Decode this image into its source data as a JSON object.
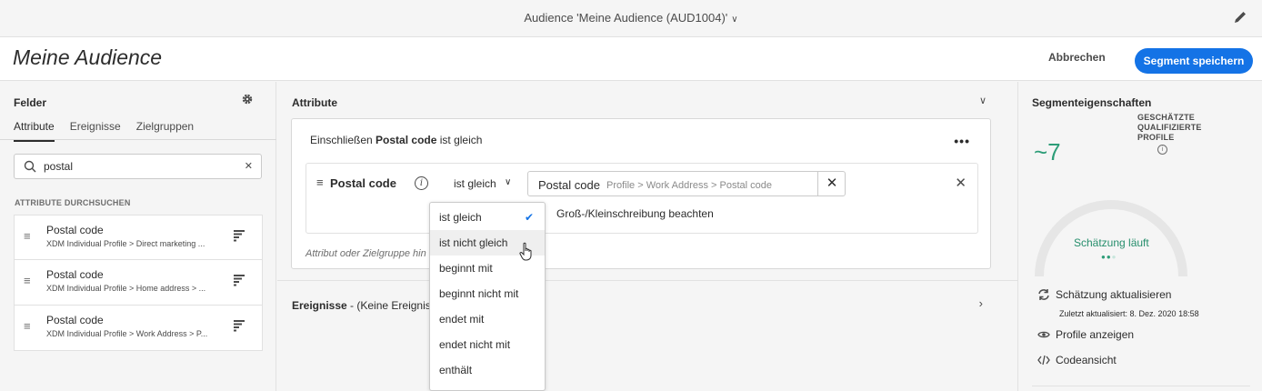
{
  "topbar": {
    "title": "Audience 'Meine Audience (AUD1004)'"
  },
  "header": {
    "page_title": "Meine Audience",
    "cancel_label": "Abbrechen",
    "save_label": "Segment speichern"
  },
  "left": {
    "title": "Felder",
    "tabs": [
      {
        "label": "Attribute",
        "active": true
      },
      {
        "label": "Ereignisse",
        "active": false
      },
      {
        "label": "Zielgruppen",
        "active": false
      }
    ],
    "search_value": "postal",
    "browse_label": "ATTRIBUTE DURCHSUCHEN",
    "items": [
      {
        "name": "Postal code",
        "path": "XDM Individual Profile > Direct marketing ..."
      },
      {
        "name": "Postal code",
        "path": "XDM Individual Profile > Home address > ..."
      },
      {
        "name": "Postal code",
        "path": "XDM Individual Profile > Work Address > P..."
      }
    ]
  },
  "center": {
    "section_title": "Attribute",
    "include_prefix": "Einschließen",
    "include_field": "Postal code",
    "include_suffix": "ist gleich",
    "rule": {
      "field": "Postal code",
      "operator": "ist gleich",
      "value_name": "Postal code",
      "value_path": "Profile > Work Address > Postal code",
      "case_label": "Groß-/Kleinschreibung beachten"
    },
    "add_label": "Attribut oder Zielgruppe hin",
    "events_title": "Ereignisse",
    "events_suffix": "- (Keine Ereignisse)"
  },
  "dropdown": {
    "options": [
      "ist gleich",
      "ist nicht gleich",
      "beginnt mit",
      "beginnt nicht mit",
      "endet mit",
      "endet nicht mit",
      "enthält"
    ],
    "selected": "ist gleich",
    "hovered": "ist nicht gleich"
  },
  "right": {
    "title": "Segmenteigenschaften",
    "estimate_label_line1": "GESCHÄTZTE",
    "estimate_label_line2": "QUALIFIZIERTE",
    "estimate_label_line3": "PROFILE",
    "count": "~7",
    "running": "Schätzung läuft",
    "refresh_label": "Schätzung aktualisieren",
    "updated_label": "Zuletzt aktualisiert: 8. Dez. 2020 18:58",
    "view_profiles_label": "Profile anzeigen",
    "code_view_label": "Codeansicht",
    "accent_color": "#2d9d78"
  }
}
